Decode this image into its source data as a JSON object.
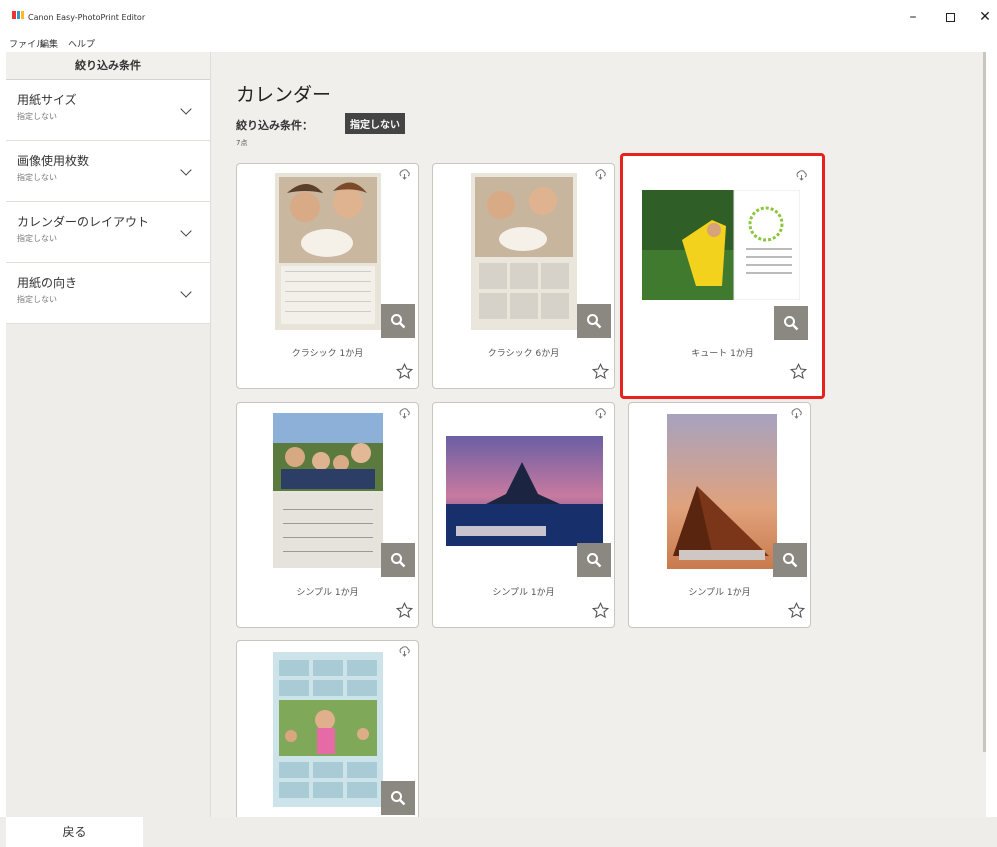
{
  "window": {
    "title": "Canon Easy-PhotoPrint Editor"
  },
  "menu": {
    "items": [
      "ファイル",
      "編集",
      "ヘルプ"
    ]
  },
  "sidebar": {
    "header": "絞り込み条件",
    "filters": [
      {
        "title": "用紙サイズ",
        "value": "指定しない"
      },
      {
        "title": "画像使用枚数",
        "value": "指定しない"
      },
      {
        "title": "カレンダーのレイアウト",
        "value": "指定しない"
      },
      {
        "title": "用紙の向き",
        "value": "指定しない"
      }
    ]
  },
  "main": {
    "title": "カレンダー",
    "filter_label": "絞り込み条件：",
    "filter_badge": "指定しない",
    "count": "7点",
    "templates": [
      {
        "label": "クラシック 1か月",
        "selected": false
      },
      {
        "label": "クラシック 6か月",
        "selected": false
      },
      {
        "label": "キュート 1か月",
        "selected": true
      },
      {
        "label": "シンプル 1か月",
        "selected": false
      },
      {
        "label": "シンプル 1か月",
        "selected": false
      },
      {
        "label": "シンプル 1か月",
        "selected": false
      },
      {
        "label": "",
        "selected": false
      }
    ]
  },
  "footer": {
    "back_label": "戻る"
  },
  "colors": {
    "selection": "#e8221c",
    "zoom_button": "#8b8882",
    "sidebar_bg": "#efede9"
  }
}
